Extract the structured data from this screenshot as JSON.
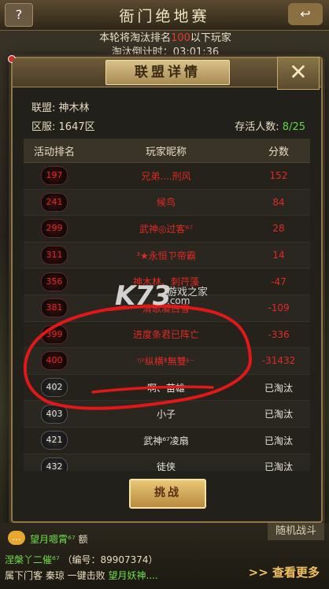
{
  "topbar": {
    "title": "衙门绝地赛",
    "back_icon": "?"
  },
  "notice": {
    "line1_prefix": "本轮将淘汰排名",
    "line1_num": "100",
    "line1_suffix": "以下玩家",
    "line2": "淘汰倒计时：03:01:36"
  },
  "modal": {
    "title": "联盟详情",
    "close": "✕",
    "alliance_label": "联盟:",
    "alliance_name": "神木林",
    "server_label": "区服:",
    "server_value": "1647区",
    "survivors_label": "存活人数:",
    "survivors_value": "8/25",
    "columns": [
      "活动排名",
      "玩家昵称",
      "分数"
    ],
    "rows": [
      {
        "rank": "197",
        "name": "兄弟....刑风",
        "score": "152",
        "status": "red"
      },
      {
        "rank": "241",
        "name": "候鸟",
        "score": "84",
        "status": "red"
      },
      {
        "rank": "299",
        "name": "武神◎过客⁶⁷",
        "score": "28",
        "status": "red"
      },
      {
        "rank": "311",
        "name": "³★永恒ㄗ帝霸",
        "score": "14",
        "status": "red"
      },
      {
        "rank": "356",
        "name": "神木林、刺荇藻",
        "score": "-47",
        "status": "red"
      },
      {
        "rank": "381",
        "name": "清歌凝白雪",
        "score": "-109",
        "status": "red"
      },
      {
        "rank": "399",
        "name": "进度条君已阵亡",
        "score": "-336",
        "status": "red"
      },
      {
        "rank": "400",
        "name": "ᵑᶻ纵横ᶲ無雙ᶳ⁻",
        "score": "-31432",
        "status": "red"
      },
      {
        "rank": "402",
        "name": "啊、苗雄",
        "score": "已淘汰",
        "status": "white"
      },
      {
        "rank": "403",
        "name": "小子",
        "score": "已淘汰",
        "status": "white"
      },
      {
        "rank": "421",
        "name": "武神⁶⁷凌扇",
        "score": "已淘汰",
        "status": "white"
      },
      {
        "rank": "432",
        "name": "徒侠",
        "score": "已淘汰",
        "status": "white"
      }
    ],
    "challenge_button": "挑战"
  },
  "watermark": {
    "logo": "K73",
    "text": "游戏之家",
    "domain": ".com"
  },
  "bottom": {
    "random_fight": "随机战斗",
    "chat1_name": "望月嗯霄",
    "chat1_sup": "⁶⁷",
    "chat1_text": "额",
    "chat2_name": "涅槃丫⼆催",
    "chat2_sup": "⁶⁷",
    "chat2_id": "（编号：89907374）",
    "chat3_text": "属下门客 秦琼 一键击败",
    "chat3_name": "望月妖神....",
    "see_more": "查看更多"
  },
  "colors": {
    "accent_gold": "#a58c55",
    "dead_red": "#e02a24",
    "alive_green": "#5fd64a"
  }
}
